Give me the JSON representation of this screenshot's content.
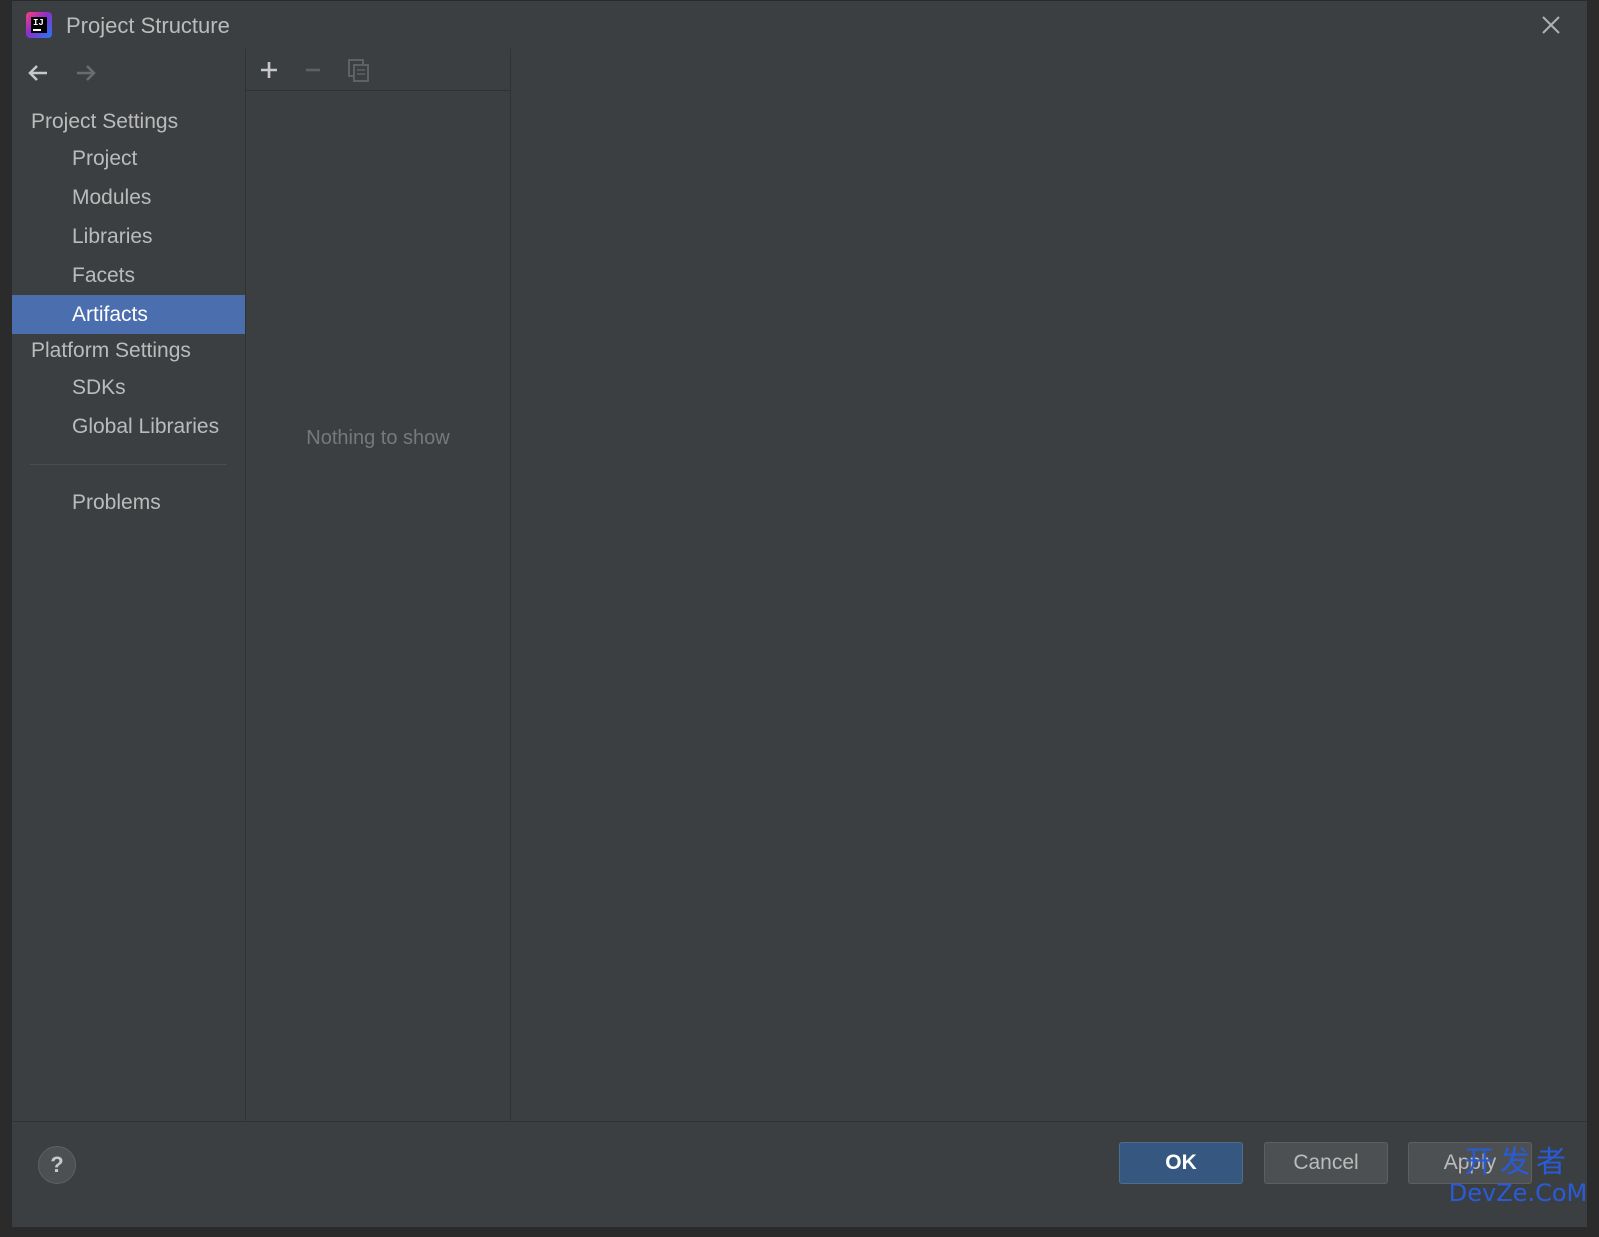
{
  "window": {
    "title": "Project Structure"
  },
  "sidebar": {
    "sections": [
      {
        "label": "Project Settings",
        "items": [
          "Project",
          "Modules",
          "Libraries",
          "Facets",
          "Artifacts"
        ]
      },
      {
        "label": "Platform Settings",
        "items": [
          "SDKs",
          "Global Libraries"
        ]
      }
    ],
    "extra": "Problems",
    "selected": "Artifacts"
  },
  "list_panel": {
    "empty_text": "Nothing to show"
  },
  "footer": {
    "help": "?",
    "ok_label": "OK",
    "cancel_label": "Cancel",
    "apply_label": "Apply"
  },
  "watermark": {
    "line1": "开发者",
    "line2": "DevZe.CoM"
  },
  "colors": {
    "selection": "#4b6eaf",
    "background": "#3c3f41",
    "ok_button": "#365880",
    "watermark": "#2a5bd7"
  },
  "icons": [
    "app-icon",
    "close-icon",
    "back-arrow-icon",
    "forward-arrow-icon",
    "add-icon",
    "remove-icon",
    "copy-icon",
    "help-icon"
  ]
}
